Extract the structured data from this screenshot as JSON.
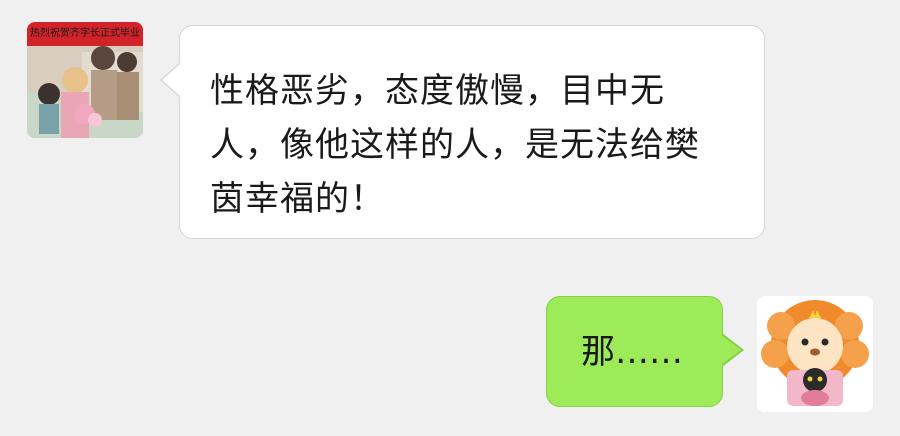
{
  "messages": [
    {
      "side": "left",
      "text": "性格恶劣，态度傲慢，目中无人，像他这样的人，是无法给樊茵幸福的！",
      "avatar": {
        "banner_text": "热烈祝贺齐字长正式毕业",
        "icon": "manga-group-avatar"
      }
    },
    {
      "side": "right",
      "text": "那……",
      "avatar": {
        "icon": "lion-cartoon-avatar"
      }
    }
  ],
  "colors": {
    "background": "#f0f0f0",
    "incoming_bubble": "#ffffff",
    "outgoing_bubble": "#9deb58"
  }
}
